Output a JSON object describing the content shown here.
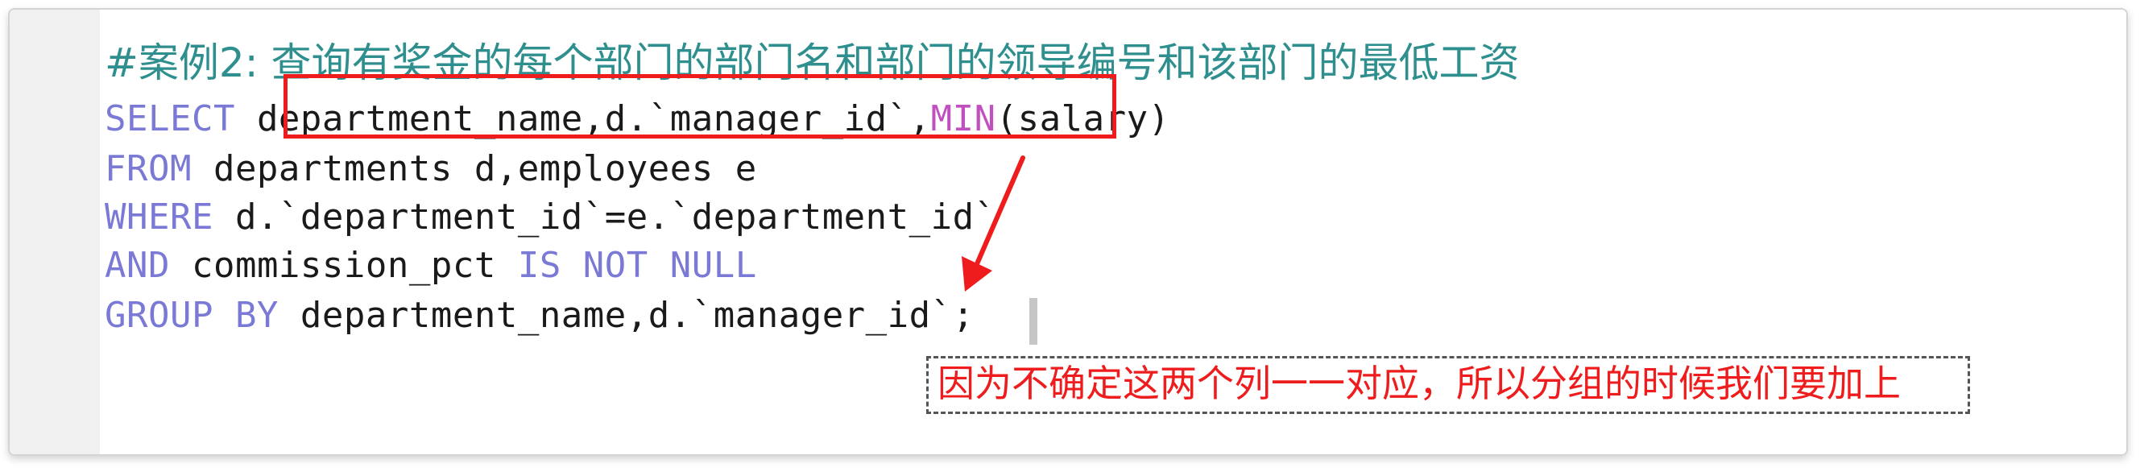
{
  "editor": {
    "comment": "#案例2: 查询有奖金的每个部门的部门名和部门的领导编号和该部门的最低工资",
    "lines": [
      {
        "kw1": "SELECT ",
        "boxed": "department_name,d.`manager_id`",
        "sep": ",",
        "fn": "MIN",
        "rest": "(salary)"
      },
      {
        "kw": "FROM ",
        "rest": "departments d,employees e"
      },
      {
        "kw": "WHERE ",
        "rest": "d.`department_id`=e.`department_id`"
      },
      {
        "kw": "AND ",
        "mid": "commission_pct ",
        "kw2": "IS NOT NULL"
      },
      {
        "kw": "GROUP BY ",
        "rest": "department_name,d.`manager_id`;"
      }
    ]
  },
  "annotation": {
    "note": "因为不确定这两个列一一对应，所以分组的时候我们要加上",
    "highlight_color": "#ee1c1c"
  },
  "colors": {
    "keyword": "#7a7ad6",
    "function": "#c050c0",
    "comment": "#2f8f8f",
    "code": "#1a1a1a"
  }
}
